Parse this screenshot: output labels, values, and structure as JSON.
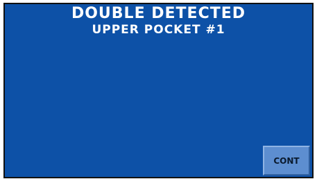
{
  "screen": {
    "title": "DOUBLE DETECTED",
    "subtitle": "UPPER POCKET #1",
    "background_color": "#0d51a7"
  },
  "actions": {
    "continue_label": "CONT"
  }
}
